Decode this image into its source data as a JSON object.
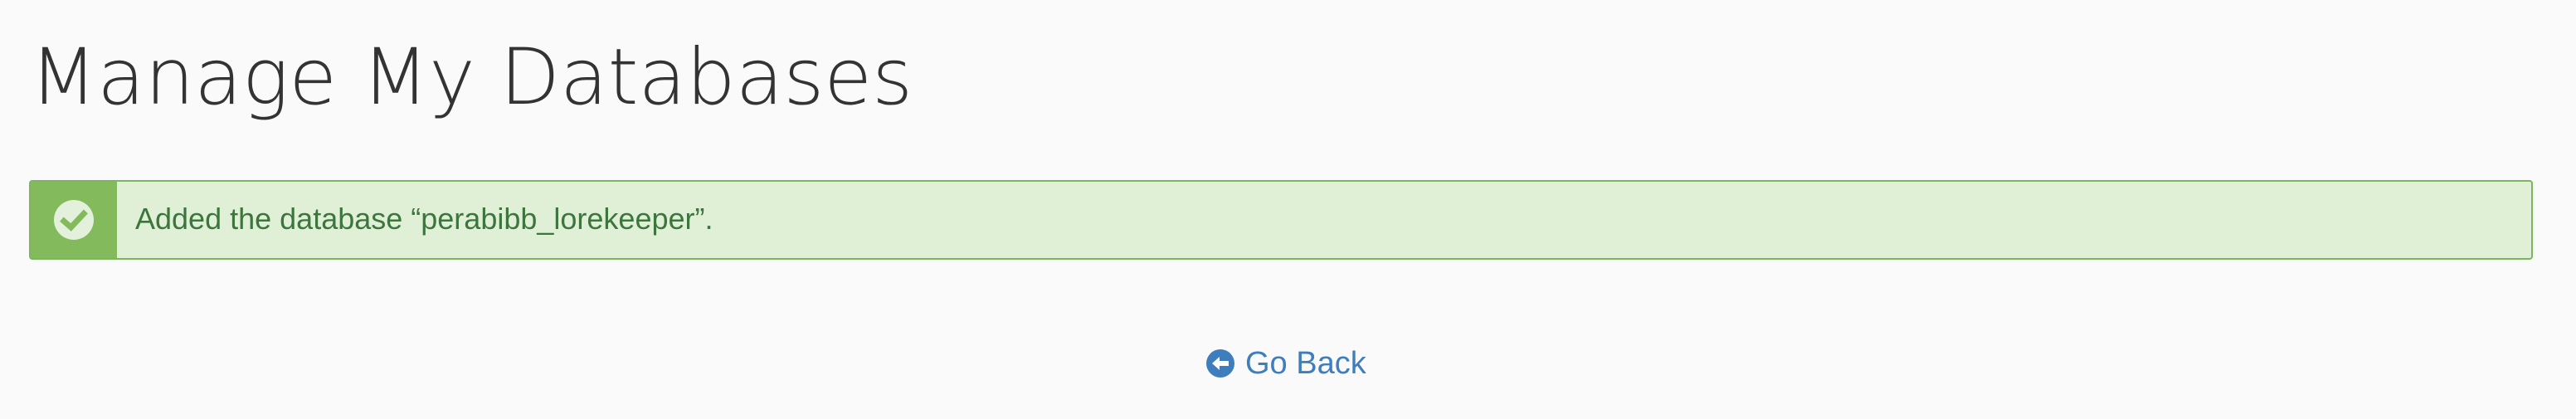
{
  "page": {
    "title": "Manage My Databases"
  },
  "alert": {
    "type": "success",
    "icon": "check-circle-icon",
    "message": "Added the database “perabibb_lorekeeper”."
  },
  "navigation": {
    "back_label": "Go Back",
    "back_icon": "arrow-circle-left-icon"
  },
  "colors": {
    "success_accent": "#83bb5c",
    "success_background": "#dff0d7",
    "success_text": "#3c763d",
    "link": "#3f7ebd"
  }
}
